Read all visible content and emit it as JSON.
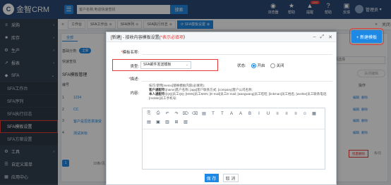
{
  "app": {
    "logo_mark": "C",
    "logo_text": "金智CRM"
  },
  "search": {
    "placeholder": "客户名称,电话快速查找",
    "button": "搜索"
  },
  "top_icons": [
    {
      "label": "浏览器",
      "glyph": "◉"
    },
    {
      "label": "帮助",
      "glyph": "★"
    },
    {
      "label": "提醒",
      "glyph": "▲",
      "badge": "1397"
    },
    {
      "label": "帮助",
      "glyph": "?"
    },
    {
      "label": "反馈",
      "glyph": "▣"
    }
  ],
  "user": {
    "name": "管理员"
  },
  "sidebar": {
    "items": [
      {
        "label": "采购",
        "icon": "≡",
        "type": "group"
      },
      {
        "label": "库存",
        "icon": "■",
        "type": "group"
      },
      {
        "label": "生产",
        "icon": "⚙",
        "type": "group"
      },
      {
        "label": "报表",
        "icon": "↗",
        "type": "group"
      },
      {
        "label": "SFA",
        "icon": "◆",
        "type": "group"
      },
      {
        "label": "SFA工作台",
        "type": "sub"
      },
      {
        "label": "SFA序列",
        "type": "sub"
      },
      {
        "label": "SFA执行日志",
        "type": "sub"
      },
      {
        "label": "SFA模板设置",
        "type": "sub",
        "selected": true
      },
      {
        "label": "SFA方案设置",
        "type": "sub"
      },
      {
        "label": "工具",
        "icon": "⚙",
        "type": "group"
      },
      {
        "label": "自定义菜单",
        "icon": "☰",
        "type": "group"
      },
      {
        "label": "应用中心",
        "icon": "▦",
        "type": "group"
      }
    ]
  },
  "tabs": [
    {
      "label": "工作台"
    },
    {
      "label": "SFA工作台"
    },
    {
      "label": "SFA序列"
    },
    {
      "label": "SFA执行日志"
    },
    {
      "label": "SFA模板设置",
      "active": true
    }
  ],
  "tab_right": {
    "refresh": "⟳",
    "close": "关闭"
  },
  "background": {
    "all_tab": "全部",
    "filter_label": "基础分类:",
    "filter_pill": "全部",
    "quick_label": "快速查找",
    "title": "SFA模板管理",
    "col_no": "编号",
    "rows": [
      {
        "no": "1",
        "name": "1234"
      },
      {
        "no": "2",
        "name": "CC"
      },
      {
        "no": "3",
        "name": "客户是否愿意接受"
      },
      {
        "no": "4",
        "name": "测试目标"
      }
    ],
    "page": "1",
    "pager_text": "10条/页",
    "new_button": "+ 新建模板",
    "right_select": "请选择",
    "close_all": "关闭编辑",
    "op_head": "操作",
    "op_edit": "编辑",
    "op_delete": "删除",
    "delete_selected": "批量删除",
    "right_text": "条/页"
  },
  "modal": {
    "title_prefix": "[新建] - 接收内容模板设置(",
    "title_req": "*表示必填项",
    "title_suffix": ")",
    "win": [
      "–",
      "⤢",
      "✕"
    ],
    "name_label": "模板名称:",
    "type_label": "类型:",
    "type_value": "SFA邮件发送模板",
    "status_label": "状态:",
    "status_on": "开启",
    "status_off": "关闭",
    "desc_label": "描述:",
    "content_label": "内容:",
    "tips_line1": "技巧:使用[memo]替换模板内容(必填项);",
    "tips_line2_bold": "客户通配符:",
    "tips_line2": "[name]客户名称; [app]客户联系方式; [company]客户公司名称;",
    "tips_line3_bold": "本人通配符:",
    "tips_line3": "[QQ]员工QQ; [MSN]员工MSN; [E-mail]员工E-mail; [wangwang]员工旺旺; [linkman]员工姓名; [workte]员工联系电话; [mobile]员工手机号;",
    "toolbar_icons": [
      "⎘",
      "⎙",
      "↶",
      "↷",
      "⌦",
      "⌫",
      "▤",
      "T",
      "T",
      "A",
      "A",
      "B",
      "I",
      "U",
      "≡",
      "≡",
      "≡",
      "☺",
      "▦",
      "▤",
      "▣",
      "▥",
      "⊞",
      "▧"
    ],
    "save": "保 存",
    "cancel": "取 消"
  }
}
